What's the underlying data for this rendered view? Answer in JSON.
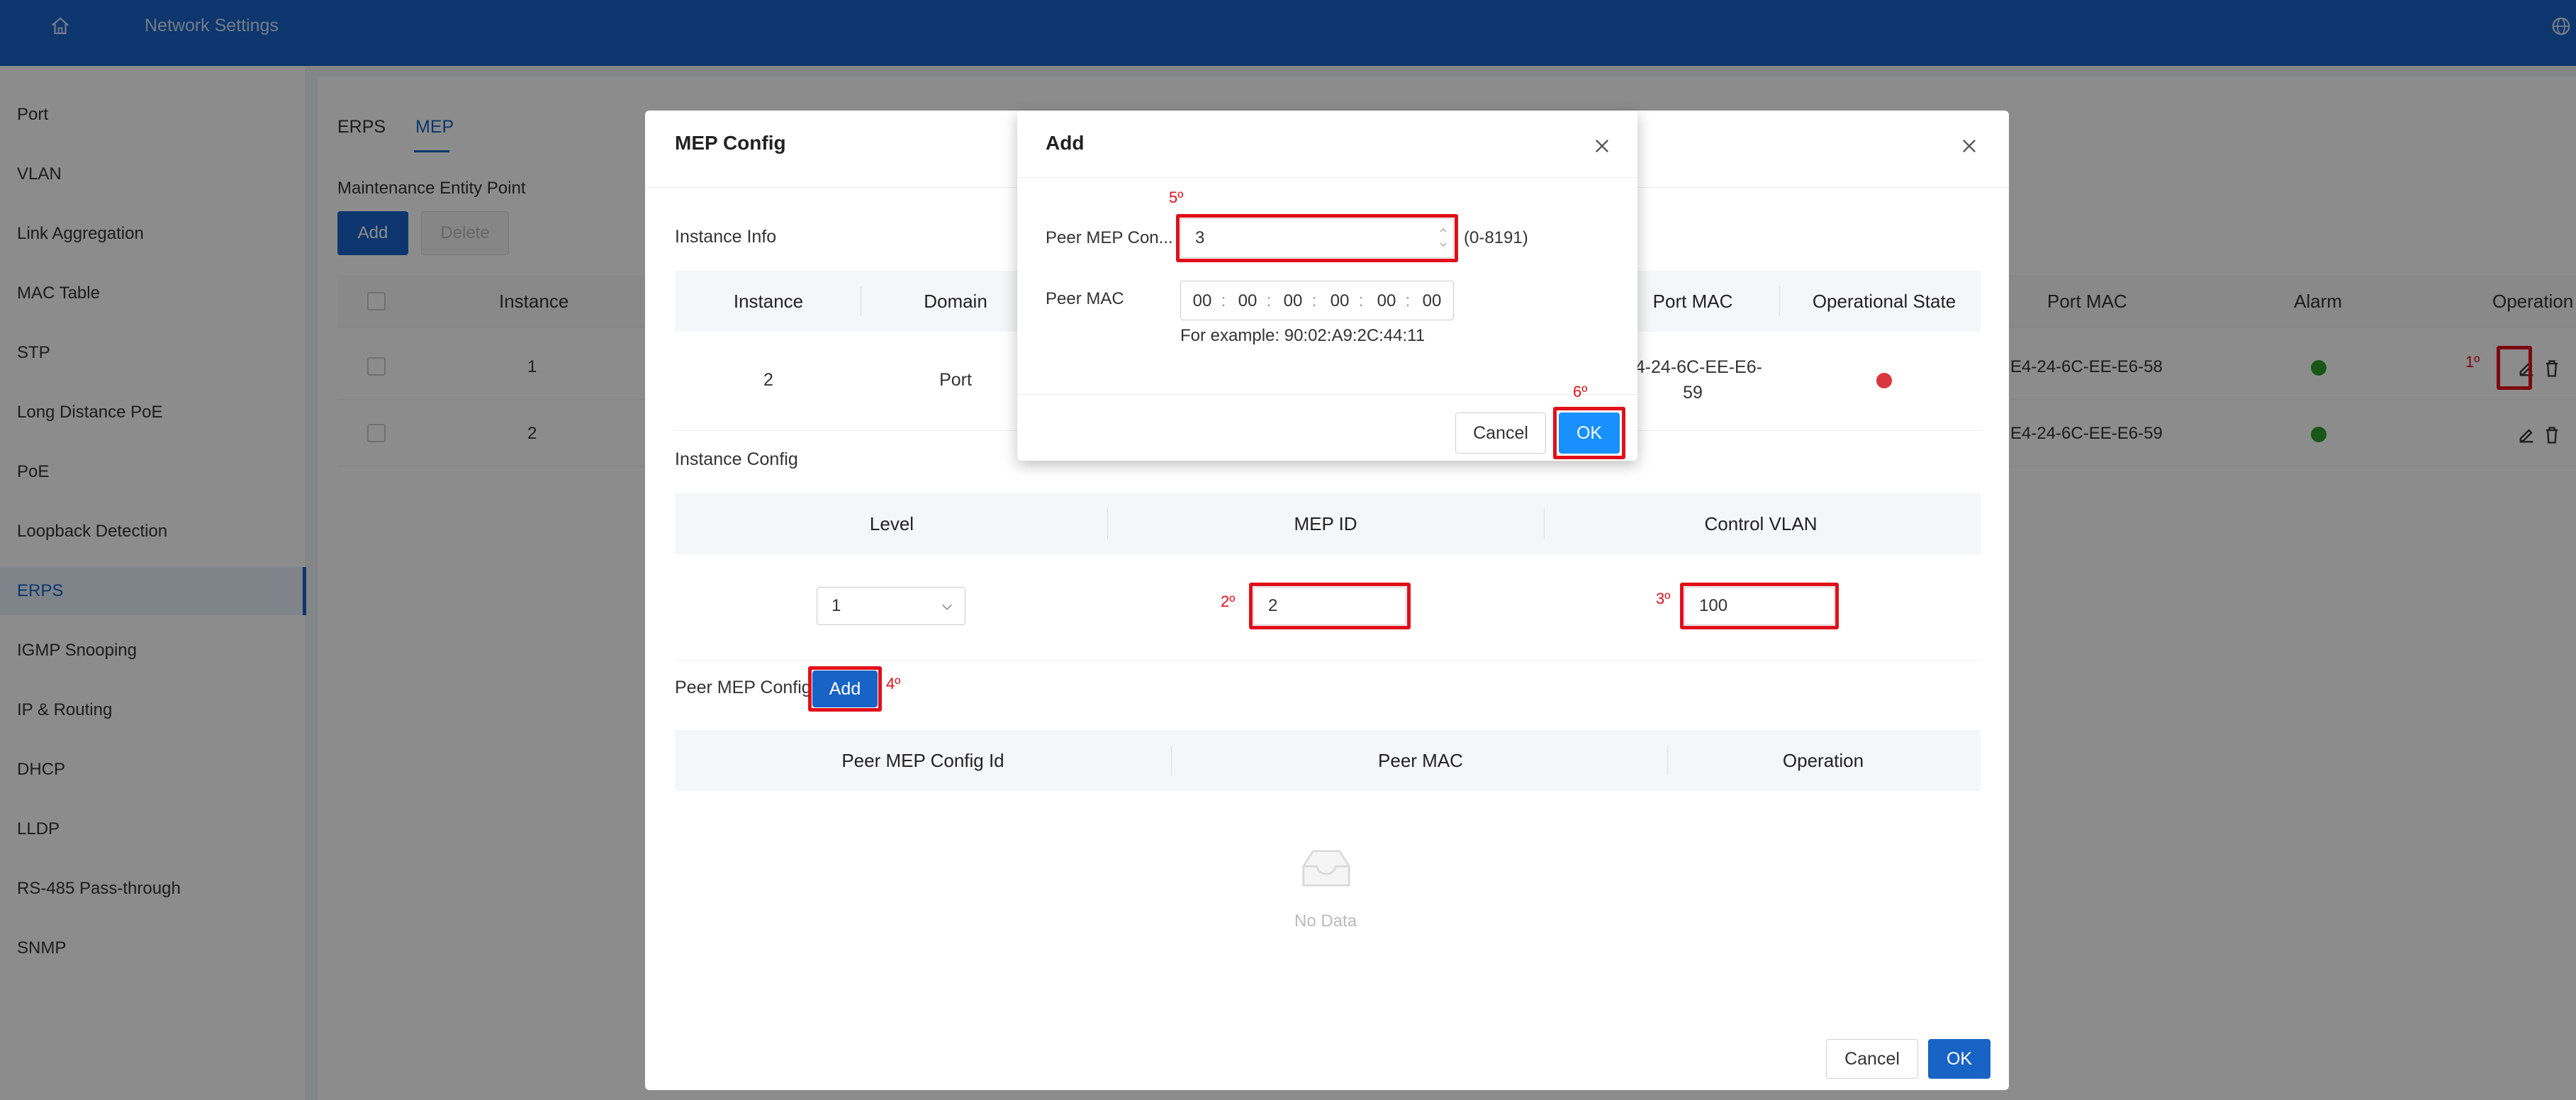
{
  "header": {
    "title": "Network Settings",
    "home_icon": "home-icon",
    "globe_icon": "globe-icon"
  },
  "sidebar": {
    "items": [
      {
        "label": "Port"
      },
      {
        "label": "VLAN"
      },
      {
        "label": "Link Aggregation"
      },
      {
        "label": "MAC Table"
      },
      {
        "label": "STP"
      },
      {
        "label": "Long Distance PoE"
      },
      {
        "label": "PoE"
      },
      {
        "label": "Loopback Detection"
      },
      {
        "label": "ERPS"
      },
      {
        "label": "IGMP Snooping"
      },
      {
        "label": "IP & Routing"
      },
      {
        "label": "DHCP"
      },
      {
        "label": "LLDP"
      },
      {
        "label": "RS-485 Pass-through"
      },
      {
        "label": "SNMP"
      }
    ],
    "active": "ERPS"
  },
  "base": {
    "tabs": [
      "ERPS",
      "MEP"
    ],
    "active_tab": "MEP",
    "subtitle": "Maintenance Entity Point",
    "add_label": "Add",
    "delete_label": "Delete",
    "columns": [
      "Instance",
      "Port MAC",
      "Alarm",
      "Operation"
    ],
    "rows": [
      {
        "instance": "1",
        "port_mac": "E4-24-6C-EE-E6-58",
        "alarm": "green"
      },
      {
        "instance": "2",
        "port_mac": "E4-24-6C-EE-E6-59",
        "alarm": "green"
      }
    ]
  },
  "mep_modal": {
    "title": "MEP Config",
    "instance_info": {
      "label": "Instance Info",
      "columns": [
        "Instance",
        "Domain",
        "Port MAC",
        "Operational State"
      ],
      "row": {
        "instance": "2",
        "domain": "Port",
        "port_mac_line1": "E4-24-6C-EE-E6-",
        "port_mac_line2": "59",
        "state": "red"
      }
    },
    "instance_config": {
      "label": "Instance Config",
      "columns": [
        "Level",
        "MEP ID",
        "Control VLAN"
      ],
      "level": "1",
      "mep_id": "2",
      "control_vlan": "100"
    },
    "peer_config": {
      "label": "Peer MEP Config",
      "add_label": "Add",
      "columns": [
        "Peer MEP Config Id",
        "Peer MAC",
        "Operation"
      ],
      "empty_text": "No Data"
    },
    "cancel_label": "Cancel",
    "ok_label": "OK"
  },
  "add_dialog": {
    "title": "Add",
    "peer_id_label": "Peer MEP Con...",
    "peer_id_value": "3",
    "peer_id_range": "(0-8191)",
    "peer_mac_label": "Peer MAC",
    "mac_parts": [
      "00",
      "00",
      "00",
      "00",
      "00",
      "00"
    ],
    "mac_sep": ":",
    "example": "For example: 90:02:A9:2C:44:11",
    "cancel_label": "Cancel",
    "ok_label": "OK"
  },
  "annotations": {
    "step1": "1º",
    "step2": "2º",
    "step3": "3º",
    "step4": "4º",
    "step5": "5º",
    "step6": "6º"
  },
  "colors": {
    "accent": "#1763c6",
    "ok_blue": "#1890ff",
    "annotation_red": "#e0101a",
    "status_green": "#2a9d2a",
    "status_red": "#d9363e"
  }
}
